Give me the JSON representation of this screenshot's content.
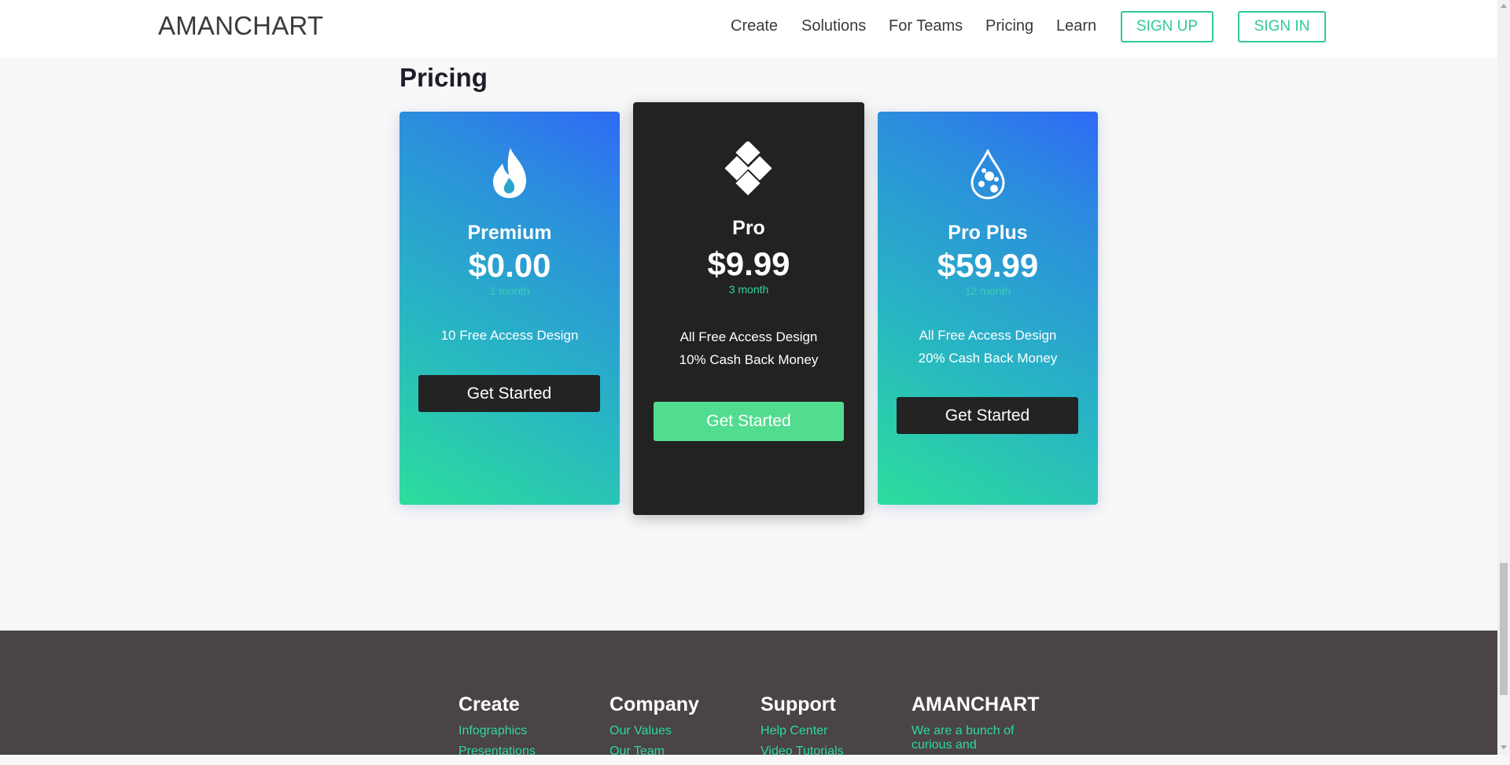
{
  "header": {
    "brand": "AMANCHART",
    "nav": [
      "Create",
      "Solutions",
      "For Teams",
      "Pricing",
      "Learn"
    ],
    "signup_label": "SIGN UP",
    "signin_label": "SIGN IN"
  },
  "main": {
    "title": "Pricing",
    "plans": [
      {
        "name": "Premium",
        "price": "$0.00",
        "period": "1 month",
        "icon": "flame-icon",
        "features": [
          "10 Free Access Design"
        ],
        "cta": "Get Started"
      },
      {
        "name": "Pro",
        "price": "$9.99",
        "period": "3 month",
        "icon": "diamond-grid-icon",
        "features": [
          "All Free Access Design",
          "10% Cash Back Money"
        ],
        "cta": "Get Started"
      },
      {
        "name": "Pro Plus",
        "price": "$59.99",
        "period": "12 month",
        "icon": "droplet-icon",
        "features": [
          "All Free Access Design",
          "20% Cash Back Money"
        ],
        "cta": "Get Started"
      }
    ]
  },
  "footer": {
    "columns": [
      {
        "heading": "Create",
        "links": [
          "Infographics",
          "Presentations"
        ]
      },
      {
        "heading": "Company",
        "links": [
          "Our Values",
          "Our Team"
        ]
      },
      {
        "heading": "Support",
        "links": [
          "Help Center",
          "Video Tutorials"
        ]
      },
      {
        "heading": "AMANCHART",
        "text": "We are a bunch of curious and"
      }
    ]
  },
  "colors": {
    "accent": "#2ec99a",
    "accent_text": "#2ed8a2",
    "dark_card": "#222223",
    "cta_green": "#52dc8f",
    "footer_bg": "#4a4444",
    "gradient_start": "#2ddd9c",
    "gradient_end": "#2f6af6"
  }
}
